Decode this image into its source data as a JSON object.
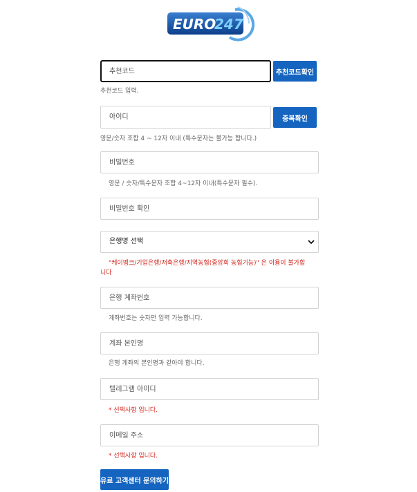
{
  "logo": {
    "word": "EURO",
    "number": "247"
  },
  "referral": {
    "placeholder": "추천코드",
    "button": "추천코드확인",
    "help": "추천코드 입력."
  },
  "user_id": {
    "placeholder": "아이디",
    "button": "중복확인",
    "help": "영문/숫자 조합 4 ~ 12자 이내 (특수문자는 불가능 합니다.)"
  },
  "password": {
    "placeholder": "비밀번호",
    "help": "영문 / 숫자/특수문자 조합 4~12자 이내(특수문자 필수)."
  },
  "password_confirm": {
    "placeholder": "비밀번호 확인"
  },
  "bank": {
    "selected": "은행명 선택",
    "warning_line1": "\"케이뱅크/기업은행/저축은행/지역농협(중앙회 농협기능)\" 은 이용이 불가합",
    "warning_line2": "니다"
  },
  "account_number": {
    "placeholder": "은행 계좌번호",
    "help": "계좌번호는 숫자만 입력 가능합니다."
  },
  "account_holder": {
    "placeholder": "계좌 본인명",
    "help": "은행 계좌의 본인명과 같아야 합니다."
  },
  "telegram": {
    "placeholder": "텔레그램 아이디",
    "note": "* 선택사항 입니다."
  },
  "email": {
    "placeholder": "이메일 주소",
    "note": "* 선택사항 입니다."
  },
  "support_button": "유료 고객센터 문의하기",
  "colors": {
    "primary": "#1565c0",
    "warning": "#d0271d"
  }
}
